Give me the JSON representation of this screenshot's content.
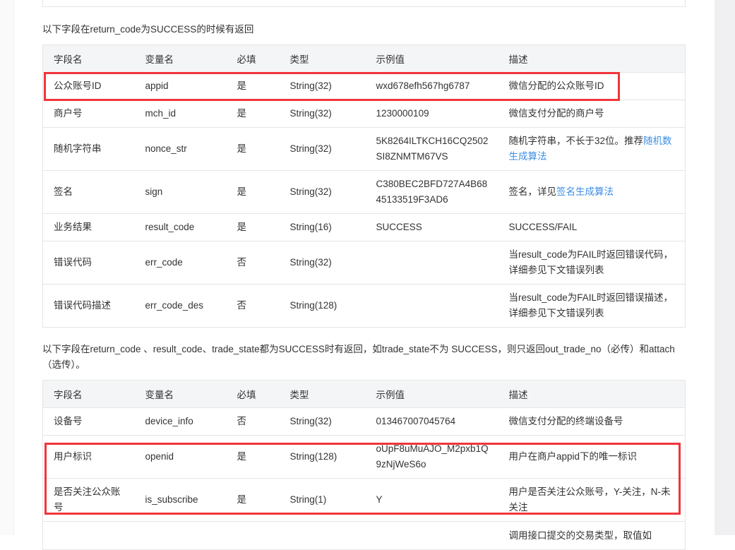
{
  "intro1": "以下字段在return_code为SUCCESS的时候有返回",
  "intro2": "以下字段在return_code 、result_code、trade_state都为SUCCESS时有返回，如trade_state不为 SUCCESS，则只返回out_trade_no（必传）和attach（选传）。",
  "headers": [
    "字段名",
    "变量名",
    "必填",
    "类型",
    "示例值",
    "描述"
  ],
  "table1": [
    {
      "name": "公众账号ID",
      "var": "appid",
      "req": "是",
      "type": "String(32)",
      "example": "wxd678efh567hg6787",
      "desc": "微信分配的公众账号ID"
    },
    {
      "name": "商户号",
      "var": "mch_id",
      "req": "是",
      "type": "String(32)",
      "example": "1230000109",
      "desc": "微信支付分配的商户号"
    },
    {
      "name": "随机字符串",
      "var": "nonce_str",
      "req": "是",
      "type": "String(32)",
      "example": "5K8264ILTKCH16CQ2502SI8ZNMTM67VS",
      "desc": "随机字符串，不长于32位。推荐",
      "link": "随机数生成算法"
    },
    {
      "name": "签名",
      "var": "sign",
      "req": "是",
      "type": "String(32)",
      "example": "C380BEC2BFD727A4B6845133519F3AD6",
      "desc": "签名，详见",
      "link": "签名生成算法"
    },
    {
      "name": "业务结果",
      "var": "result_code",
      "req": "是",
      "type": "String(16)",
      "example": "SUCCESS",
      "desc": "SUCCESS/FAIL"
    },
    {
      "name": "错误代码",
      "var": "err_code",
      "req": "否",
      "type": "String(32)",
      "example": "",
      "desc": "当result_code为FAIL时返回错误代码，详细参见下文错误列表"
    },
    {
      "name": "错误代码描述",
      "var": "err_code_des",
      "req": "否",
      "type": "String(128)",
      "example": "",
      "desc": "当result_code为FAIL时返回错误描述，详细参见下文错误列表"
    }
  ],
  "table2": [
    {
      "name": "设备号",
      "var": "device_info",
      "req": "否",
      "type": "String(32)",
      "example": "013467007045764",
      "desc": "微信支付分配的终端设备号"
    },
    {
      "name": "用户标识",
      "var": "openid",
      "req": "是",
      "type": "String(128)",
      "example": "oUpF8uMuAJO_M2pxb1Q9zNjWeS6o",
      "desc": "用户在商户appid下的唯一标识"
    },
    {
      "name": "是否关注公众账号",
      "var": "is_subscribe",
      "req": "是",
      "type": "String(1)",
      "example": "Y",
      "desc": "用户是否关注公众账号，Y-关注，N-未关注"
    },
    {
      "name": "",
      "var": "",
      "req": "",
      "type": "",
      "example": "",
      "desc": "调用接口提交的交易类型，取值如"
    }
  ]
}
